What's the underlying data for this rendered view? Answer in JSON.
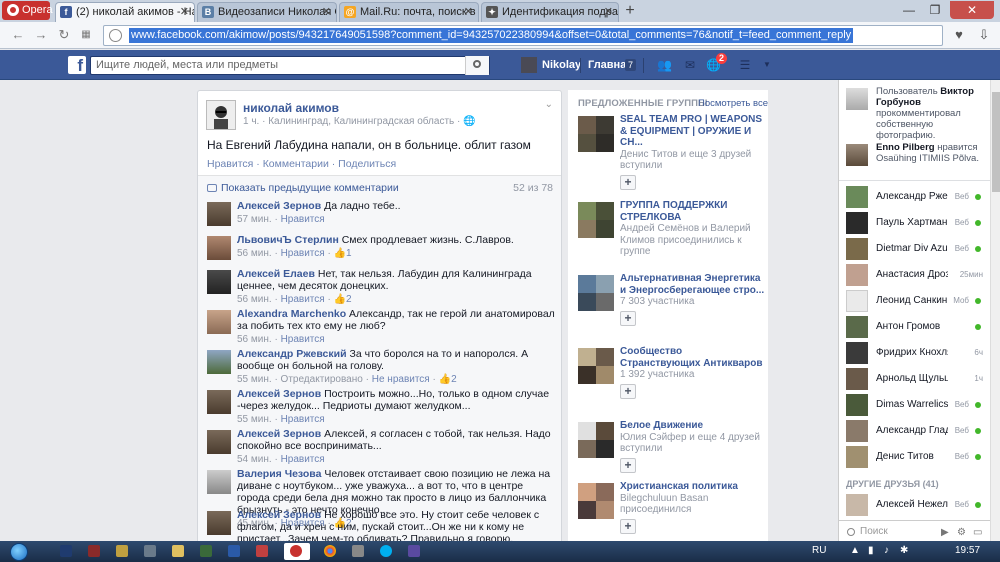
{
  "browser": {
    "menu_label": "Opera",
    "tabs": [
      {
        "title": "(2) николай акимов - На Ев...",
        "favicon": "f",
        "color": "#3b5998",
        "active": true
      },
      {
        "title": "Видеозаписи Николая Са...",
        "favicon": "B",
        "color": "#5b7fa6",
        "active": false
      },
      {
        "title": "Mail.Ru: почта, поиск в инт...",
        "favicon": "@",
        "color": "#f5a623",
        "active": false
      },
      {
        "title": "Идентификация подразде...",
        "favicon": "✦",
        "color": "#555555",
        "active": false
      }
    ],
    "new_tab": "+",
    "url": "www.facebook.com/akimow/posts/943217649051598?comment_id=943257022380994&offset=0&total_comments=76&notif_t=feed_comment_reply"
  },
  "fb": {
    "logo": "f",
    "search_placeholder": "Ищите людей, места или предметы",
    "user_name": "Nikolay",
    "home_label": "Главная",
    "home_count": "7",
    "notif_count": "2"
  },
  "post": {
    "author": "николай акимов",
    "meta": "1 ч. · Калининград, Калининградская область · ",
    "text": "На Евгений Лабудина напали, он в больнице. облит газом",
    "actions": {
      "like": "Нравится",
      "comment": "Комментарии",
      "share": "Поделиться"
    },
    "prev_comments": "Показать предыдущие комментарии",
    "count": "52 из 78",
    "comments": [
      {
        "name": "Алексей Зернов",
        "text": "Да ладно тебе..",
        "time": "57 мин.",
        "like": "Нравится",
        "likes": ""
      },
      {
        "name": "ЛьвовичЪ Стерлин",
        "text": "Смех продлевает жизнь. С.Лавров.",
        "time": "56 мин.",
        "like": "Нравится",
        "likes": "1"
      },
      {
        "name": "Алексей Елаев",
        "text": "Нет, так нельзя. Лабудин для Калининграда ценнее, чем десяток донецких.",
        "time": "56 мин.",
        "like": "Нравится",
        "likes": "2"
      },
      {
        "name": "Alexandra Marchenko",
        "text": "Александр, так не герой ли анатомировал за побить тех кто ему не люб?",
        "time": "56 мин.",
        "like": "Нравится",
        "likes": ""
      },
      {
        "name": "Александр Ржевский",
        "text": "За что боролся на то и напоролся. А вообще он больной на голову.",
        "time": "55 мин. · Отредактировано",
        "like": "Не нравится",
        "likes": "2"
      },
      {
        "name": "Алексей Зернов",
        "text": "Построить можно...Но, только в одном случае -через желудок... Педриоты думают желудком...",
        "time": "55 мин.",
        "like": "Нравится",
        "likes": ""
      },
      {
        "name": "Алексей Зернов",
        "text": "Алексей, я согласен с тобой, так нельзя. Надо спокойно все воспринимать...",
        "time": "54 мин.",
        "like": "Нравится",
        "likes": ""
      },
      {
        "name": "Валерия Чезова",
        "text": "Человек отстаивает свою позицию не лежа на диване с ноутбуком... уже уважуха... а вот то, что в центре города среди бела дня можно так просто в лицо из баллончика брызнуть - это нечто конечно...",
        "time": "45 мин.",
        "like": "Нравится",
        "likes": "2"
      },
      {
        "name": "Алексей Зернов",
        "text": "Не хорошо все это. Ну стоит себе человек с флагом, да и хрен с ним, пускай стоит...Он же ни к кому не пристает...Зачем чем-то обливать? Правильно я говорю, Львович? Всякой там зеленой, газом...",
        "time": "",
        "like": "",
        "likes": ""
      }
    ]
  },
  "groups": {
    "header": "ПРЕДЛОЖЕННЫЕ ГРУППЫ",
    "see_all": "Посмотреть все",
    "items": [
      {
        "name": "SEAL TEAM PRO | WEAPONS & EQUIPMENT | ОРУЖИЕ И СН...",
        "sub": "Денис Титов и еще 3 друзей вступили"
      },
      {
        "name": "ГРУППА ПОДДЕРЖКИ СТРЕЛКОВА",
        "sub": "Андрей Семёнов и Валерий Климов присоединились к группе"
      },
      {
        "name": "Альтернативная Энергетика и Энергосберегающее стро...",
        "sub": "7 303 участника"
      },
      {
        "name": "Сообщество Странствующих Антикваров",
        "sub": "1 392 участника"
      },
      {
        "name": "Белое Движение",
        "sub": "Юлия Сэйфер и еще 4 друзей вступили"
      },
      {
        "name": "Христианская политика",
        "sub": "Bilegchuluun Basan присоединился"
      }
    ],
    "join": "+"
  },
  "sidebar": {
    "ticker": [
      {
        "pre": "Пользователь ",
        "who": "Виктор Горбунов",
        "post": " прокомментировал собственную фотографию."
      },
      {
        "pre": "",
        "who": "Enno Pilberg",
        "post": " нравится Osaühing ITIMIIS Põlva."
      }
    ],
    "friends": [
      {
        "name": "Александр Ржевский",
        "status": "Веб",
        "online": true
      },
      {
        "name": "Пауль Хартманн",
        "status": "Веб",
        "online": true
      },
      {
        "name": "Dietmar Div Azul",
        "status": "Веб",
        "online": true
      },
      {
        "name": "Анастасия Дроздова",
        "status": "25мин",
        "online": false
      },
      {
        "name": "Леонид Санкин",
        "status": "Моб",
        "online": true
      },
      {
        "name": "Антон Громов",
        "status": "",
        "online": true
      },
      {
        "name": "Фридрих Кнохляйн",
        "status": "6ч",
        "online": false
      },
      {
        "name": "Арнольд Щульц",
        "status": "1ч",
        "online": false
      },
      {
        "name": "Dimas Warrelics",
        "status": "Веб",
        "online": true
      },
      {
        "name": "Александр Гладкий",
        "status": "Веб",
        "online": true
      },
      {
        "name": "Денис Титов",
        "status": "Веб",
        "online": true
      }
    ],
    "others_header": "ДРУГИЕ ДРУЗЬЯ (41)",
    "others": [
      {
        "name": "Алексей Нежельс...",
        "status": "Веб",
        "online": true
      }
    ],
    "search_placeholder": "Поиск"
  },
  "taskbar": {
    "lang": "RU",
    "time": "19:57"
  },
  "colors": {
    "fb_blue": "#3b5998",
    "link": "#3b5998",
    "online": "#42b72a",
    "notif_red": "#fa3e3e",
    "opera_red": "#c8312e"
  }
}
